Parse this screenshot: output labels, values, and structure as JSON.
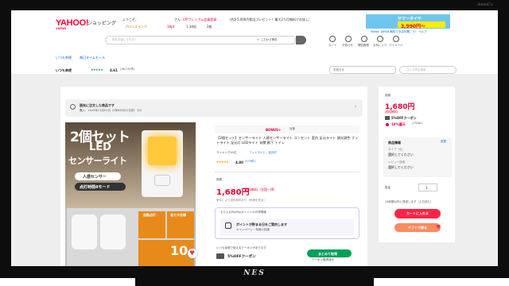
{
  "header": {
    "logo": "YAHOO!",
    "logo_sub": "JAPAN",
    "service": "ショッピング",
    "greeting": "ようこそ、",
    "greeting_suffix": "さん",
    "premium_link": "LYPプレミアム会員登録",
    "premium_note": "（合計5,000円相当プレゼント！最大2カ月無料でお試し）",
    "bronze": "ブロンズランク",
    "points": "38pt",
    "paypay": "1.34倍",
    "coupons": "2枚",
    "banner_text": "サマータイヤ",
    "banner_price": "3,990円〜",
    "top_links": "Yahoo! JAPAN  無料でお店を開こう！  ヘルプ"
  },
  "search": {
    "placeholder": "何をお探しですか？",
    "conditions_label": "＋ こだわり条件"
  },
  "nav_icons": [
    {
      "name": "cart-icon",
      "label": "カート"
    },
    {
      "name": "bell-icon",
      "label": "お知らせ"
    },
    {
      "name": "history-icon",
      "label": "閲覧履歴"
    },
    {
      "name": "heart-icon",
      "label": "お気に入り"
    },
    {
      "name": "user-icon",
      "label": "マイページ"
    }
  ],
  "breadcrumb": {
    "items": [
      "いつも幸便",
      "毎日タイムセール"
    ]
  },
  "store": {
    "name": "いつも幸便",
    "rating": "4.61",
    "review_count": "(36,132件)",
    "inquiry_label": "お知らせ",
    "store_search_placeholder": "ストア内を検索"
  },
  "notice": {
    "title": "過去に注文した商品です",
    "detail": "購入：2023年11月01日（1年6か月11日前：20）"
  },
  "product": {
    "image_title_1": "2個セット",
    "image_title_2": "LED",
    "image_title_3": "センサーライト",
    "image_badge_1": "人感センサー",
    "image_badge_2": "点灯時間4モード",
    "image_badge_3": "自動点灯",
    "image_badge_4": "省エネ仕様",
    "image_number": "10",
    "bonus_label": "BONUS+",
    "bonus_suffix": "対象",
    "title": "【2個セット】センサーライト 人感センサーライト コンセント 室内 足元ライト 調光調色 フットライト 足元灯 LEDライト 玄関 廊下 トイレ",
    "ranking": "ランキング40位",
    "ranking_category": "フットライト、足元灯",
    "rating": "4.80",
    "reviews": "(173件)",
    "price_label": "価格",
    "price": "1,680円",
    "shipping": "送料無料（全国一律）",
    "shipping_note": "条件により送料無料あり（詳細を見る）",
    "points_box_title": "もらえるPayPayポイントのお得情報",
    "points_box_text": "ポイントが貯まる日をご案内します",
    "points_box_sub": "キャンペーン・特典の詳細",
    "coupon_note": "いつも幸便で使えるクーポンがあります",
    "coupon": "5%OFFクーポン",
    "coupon_button": "まとめて取得",
    "coupon_button_sub": "クーポン獲得済み"
  },
  "sidebar": {
    "price_label": "価格",
    "price": "1,680円",
    "shipping": "送料無料",
    "coupon": "5%OFFクーポン",
    "reward": "10%還元",
    "reward_pts": "(152pt)",
    "product_info_label": "商品情報",
    "product_info_edit": "変更",
    "type_label": "タイプ（色）",
    "type_value": "選択してください",
    "review_label": "レビュー投稿",
    "review_value": "選択してください",
    "qty_label": "数量",
    "qty_value": "1",
    "delivery": "24時間以内に発送します（土日含む）",
    "cart_button": "カートに入れる",
    "gift_button": "ギフトで贈る"
  }
}
